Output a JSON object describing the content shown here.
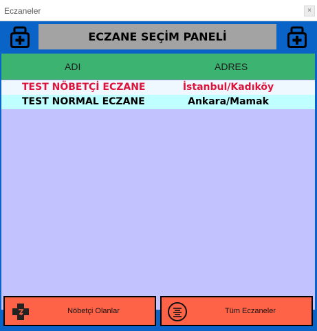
{
  "window": {
    "title": "Eczaneler",
    "close_glyph": "×"
  },
  "header": {
    "title": "ECZANE SEÇİM PANELİ",
    "left_icon": "medicine-case-icon",
    "right_icon": "medicine-case-icon"
  },
  "grid": {
    "columns": [
      "ADI",
      "ADRES"
    ],
    "rows": [
      {
        "adi": "TEST NÖBETÇİ ECZANE",
        "adres": "İstanbul/Kadıköy"
      },
      {
        "adi": "TEST NORMAL ECZANE",
        "adres": "Ankara/Mamak"
      }
    ]
  },
  "buttons": {
    "nobetci": {
      "label": "Nöbetçi Olanlar",
      "icon": "pharmacy-cross-icon"
    },
    "tum": {
      "label": "Tüm Eczaneler",
      "icon": "list-circle-icon"
    }
  },
  "colors": {
    "window_bg": "#0a64c8",
    "title_panel": "#a3a3a3",
    "grid_header": "#3cb371",
    "grid_bg": "#c2c2ff",
    "row_duty": "#dc143c",
    "button_bg": "#ff6347"
  }
}
